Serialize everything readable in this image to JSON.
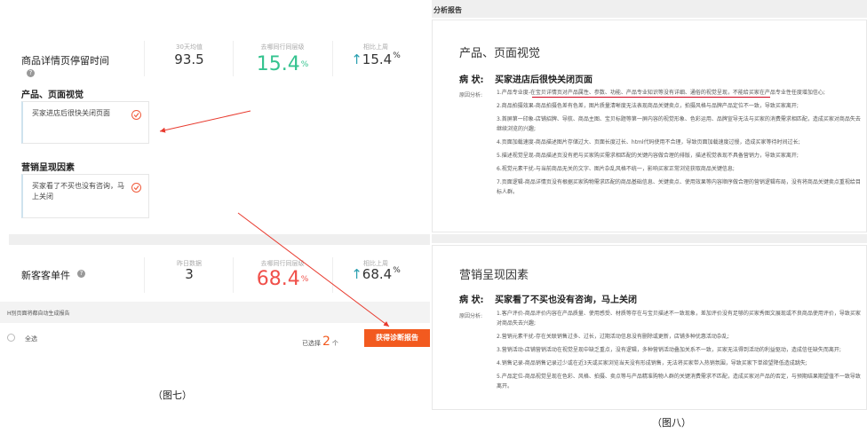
{
  "left": {
    "product_row": {
      "title": "商品详情页停留时间",
      "metrics": [
        {
          "label": "30天均值",
          "value": "93.5"
        },
        {
          "label": "去哪同行同层级",
          "value": "15.4",
          "unit": "%"
        },
        {
          "label": "相比上周",
          "value": "15.4",
          "unit": "%"
        }
      ],
      "arrow": "↑"
    },
    "section_product": {
      "title": "产品、页面视觉",
      "card_text": "买家进店后很快关闭页面"
    },
    "section_marketing": {
      "title": "营销呈现因素",
      "card_text": "买家看了不买也没有咨询，马上关闭"
    },
    "customer_row": {
      "title": "新客客单件",
      "metrics": [
        {
          "label": "昨日数据",
          "value": "3"
        },
        {
          "label": "去哪同行同层级",
          "value": "68.4",
          "unit": "%"
        },
        {
          "label": "相比上周",
          "value": "68.4",
          "unit": "%"
        }
      ],
      "arrow": "↑"
    },
    "bottom_bar": {
      "hint": "H别页面将都自动生成报告",
      "select_all": "全选",
      "selected_prefix": "已选择",
      "selected_count": "2",
      "selected_suffix": "个",
      "cta": "获得诊断报告"
    },
    "caption": "（图七）"
  },
  "right": {
    "header": "分析报告",
    "block1": {
      "heading": "产品、页面视觉",
      "symptom_label": "病 状:",
      "symptom": "买家进店后很快关闭页面",
      "reason_label": "原因分析:",
      "lines": [
        "1.产品专业度-在宝贝详情页对产品属性、参数、功能、产品专业知识等没有详细、通俗的视觉呈现，不能给买家在产品专业性任度增加信心;",
        "2.商品拍摄效果-商品拍摄色差有色差，图片质量清晰度无法表现商品关键卖点，拍摄风格与品牌产品定位不一致，导致买家离开;",
        "3.首屏第一印象-店铺招牌、导航、商品主图、宝贝标题等第一屏内容的视觉形象、色彩运用、品牌宣导无法与买家的消费需求相匹配，造成买家对商品失去继续浏览的兴趣;",
        "4.页面加载速度-商品描述图片存储过大、页面长度过长、html代码使用不合理，导致页面加载速度过慢，造成买家等待时间过长;",
        "5.描述视觉呈现-商品描述页没有把与买家购买需求相匹配的关键内容做合理的排版，描述视觉表现不具备营销力，导致买家离开;",
        "6.视觉元素干扰-与当前商品无关的文字、图片杂乱风格不统一，影响买家正常浏览获取商品关键信息;",
        "7.页面逻辑-商品详情页没有根据买家购物需求匹配的商品基础信息、关键卖点、使用效果等内容顺序做合理的营销逻辑布局，没有将商品关键卖点重视给目标人群。"
      ]
    },
    "block2": {
      "heading": "营销呈现因素",
      "symptom_label": "病 状:",
      "symptom": "买家看了不买也没有咨询，马上关闭",
      "reason_label": "原因分析:",
      "lines": [
        "1.客户评价-商品评价内容在产品质量、使用感受、材质等存在与宝贝描述不一致现象，差加评价没有足够的买家秀图文展现或不良商品使用评价，导致买家对商品失去兴趣;",
        "2.营销元素干扰-存在关联销售过多、过长，过期活动信息没有删除或更新，店铺多种优惠活动杂乱;",
        "3.营销活动-店铺营销活动在视觉呈现中缺乏重点，没有逻辑，多种营销活动叠加关系不一致，买家无法得到活动的利益驱动，造成信任缺失而离开;",
        "4.销售记录-商品销售记录过少或在近3天或买家浏览当天没有形成销售，无法将买家带入热销氛围，导致买家下单欲望降低造成跳失;",
        "5.产品定位-商品视觉呈现在色彩、风格、拍摄、卖点等与产品精准购物人群的关键消费需求不匹配，造成买家对产品的否定，与预期结果期望值不一致导致离开。"
      ]
    },
    "caption": "（图八）"
  },
  "colors": {
    "green": "#34c38f",
    "red": "#f0504a",
    "teal": "#2a9fb0",
    "orange": "#f25a1f"
  }
}
